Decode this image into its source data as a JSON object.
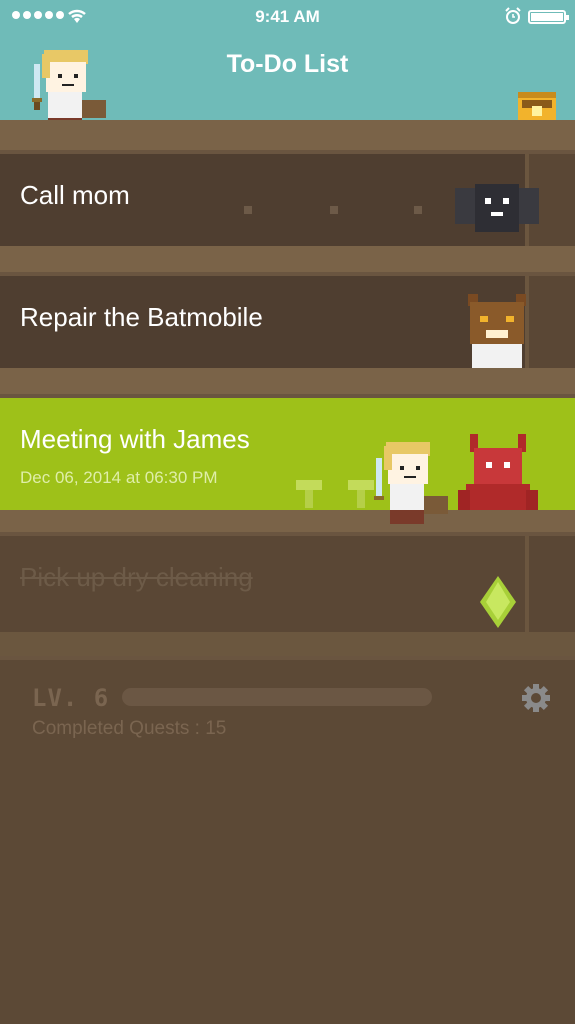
{
  "status_bar": {
    "time": "9:41 AM"
  },
  "header": {
    "title": "To-Do List"
  },
  "tasks": [
    {
      "label": "Call mom",
      "enemy": "bat-icon"
    },
    {
      "label": "Repair the Batmobile",
      "enemy": "werewolf-icon"
    },
    {
      "label": "Meeting with James",
      "subtitle": "Dec 06, 2014 at 06:30 PM",
      "enemy": "demon-icon"
    },
    {
      "label": "Pick up dry cleaning",
      "reward": "gem-icon"
    }
  ],
  "stats": {
    "level": "LV. 6",
    "completed": "Completed Quests : 15"
  },
  "colors": {
    "header": "#6fbbb8",
    "active_row": "#9ec119",
    "background": "#5f4b38"
  }
}
